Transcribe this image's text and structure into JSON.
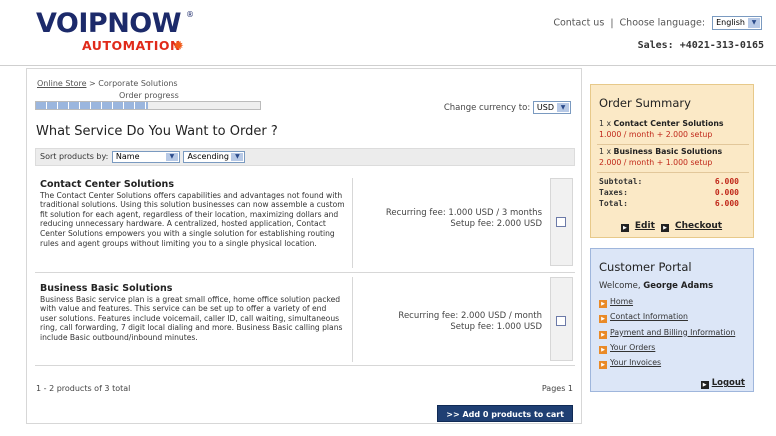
{
  "header": {
    "logo_main": "VOIPNOW",
    "logo_reg": "®",
    "logo_sub": "AUTOMATION",
    "contact_label": "Contact us",
    "separator": "|",
    "language_label": "Choose language:",
    "language_value": "English",
    "sales_text": "Sales: +4021-313-0165"
  },
  "breadcrumb": {
    "store": "Online Store",
    "separator": ">",
    "current": "Corporate Solutions"
  },
  "progress": {
    "label": "Order progress",
    "fraction": 0.5
  },
  "currency": {
    "label": "Change currency to:",
    "value": "USD"
  },
  "heading": "What Service Do You Want to Order ?",
  "sort": {
    "label": "Sort products by:",
    "field": "Name",
    "order": "Ascending"
  },
  "products": [
    {
      "name": "Contact Center Solutions",
      "description": "The Contact Center Solutions offers capabilities and advantages not found with traditional solutions. Using this solution businesses can now assemble a custom fit solution for each agent, regardless of their location, maximizing dollars and reducing unnecessary hardware. A centralized, hosted application, Contact Center Solutions empowers you with a single solution for establishing routing rules and agent groups without limiting you to a single physical location.",
      "recurring_fee": "Recurring fee:  1.000 USD / 3 months",
      "setup_fee": "Setup fee:  2.000 USD"
    },
    {
      "name": "Business Basic Solutions",
      "description": "Business Basic service plan is a great small office, home office solution packed with value and features. This service can be set up to offer a variety of end user solutions. Features include voicemail, caller ID, call waiting, simultaneous ring, call forwarding, 7 digit local dialing and more. Business Basic calling plans include Basic outbound/inbound minutes.",
      "recurring_fee": "Recurring fee:  2.000 USD / month",
      "setup_fee": "Setup fee:  1.000 USD"
    }
  ],
  "footer": {
    "count_text": "1 - 2 products of 3 total",
    "pages_text": "Pages 1",
    "add_button": ">> Add 0 products to cart"
  },
  "summary": {
    "title": "Order Summary",
    "items": [
      {
        "qty": "1 x",
        "name": "Contact Center Solutions",
        "price": "1.000 / month + 2.000 setup"
      },
      {
        "qty": "1 x",
        "name": "Business Basic Solutions",
        "price": "2.000 / month + 1.000 setup"
      }
    ],
    "subtotal_label": "Subtotal:",
    "subtotal_value": "6.000",
    "taxes_label": "Taxes:",
    "taxes_value": "0.000",
    "total_label": "Total:",
    "total_value": "6.000",
    "edit_label": "Edit",
    "checkout_label": "Checkout"
  },
  "portal": {
    "title": "Customer Portal",
    "welcome_prefix": "Welcome,",
    "user_name": "George Adams",
    "links": [
      "Home",
      "Contact Information",
      "Payment and Billing Information",
      "Your Orders",
      "Your Invoices"
    ],
    "logout_label": "Logout"
  },
  "colors": {
    "brand_navy": "#1c2a6a",
    "brand_red": "#e02a1a",
    "summary_bg": "#fbe9c6",
    "portal_bg": "#dce6f7",
    "price_red": "#c0281a",
    "button_blue": "#1f3f73"
  },
  "icons": {
    "logo_burst": "sunburst-icon",
    "select_arrow": "chevron-down-icon",
    "bullet": "square-arrow-icon"
  }
}
